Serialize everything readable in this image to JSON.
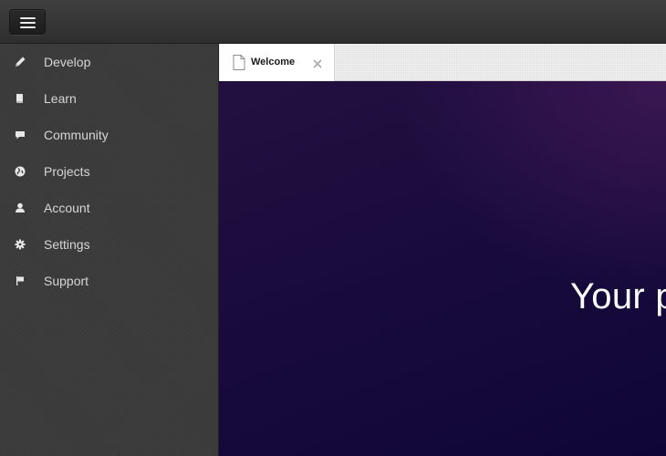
{
  "topbar": {
    "menu_button": "hamburger-menu"
  },
  "sidebar": {
    "items": [
      {
        "label": "Develop",
        "icon": "pencil-icon"
      },
      {
        "label": "Learn",
        "icon": "book-icon"
      },
      {
        "label": "Community",
        "icon": "comment-icon"
      },
      {
        "label": "Projects",
        "icon": "globe-icon"
      },
      {
        "label": "Account",
        "icon": "user-icon"
      },
      {
        "label": "Settings",
        "icon": "gear-icon"
      },
      {
        "label": "Support",
        "icon": "flag-icon"
      }
    ]
  },
  "tabs": [
    {
      "label": "Welcome",
      "icon": "document-icon",
      "active": true
    }
  ],
  "content": {
    "hero_text": "Your p"
  },
  "colors": {
    "sidebar_bg": "#3b3b3b",
    "sidebar_text": "#d6d6d6",
    "content_bg": "#1a0c3d",
    "hero_text": "#ffffff"
  }
}
